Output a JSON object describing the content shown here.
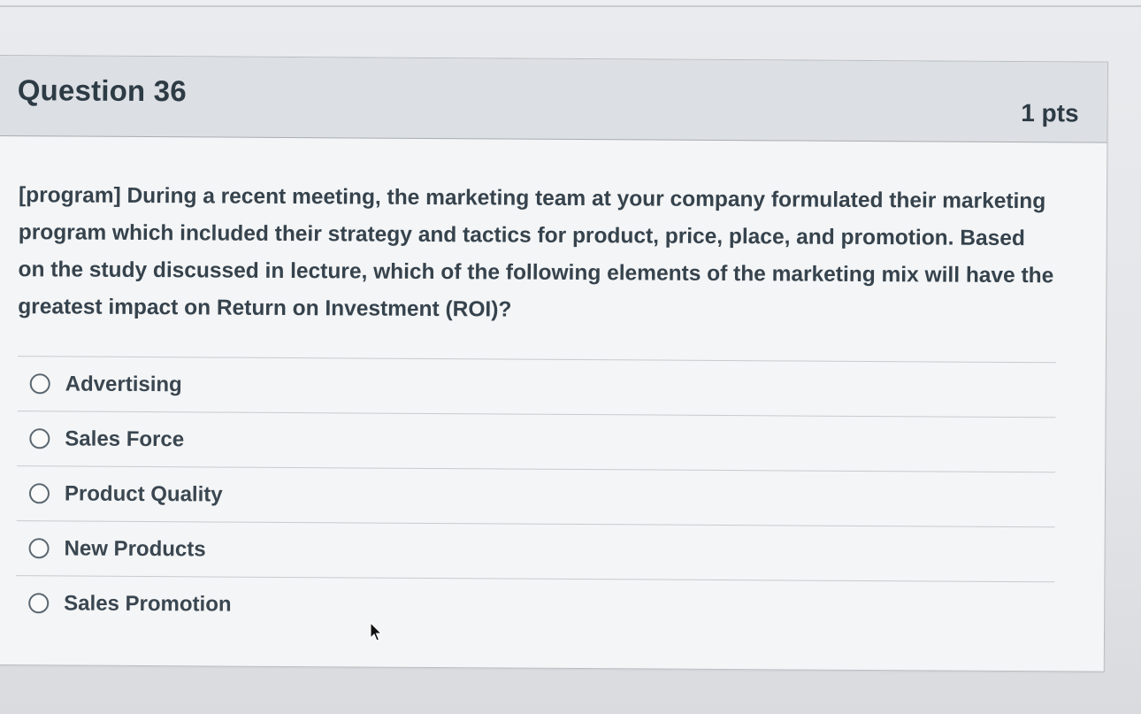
{
  "question": {
    "title": "Question 36",
    "points": "1 pts",
    "text": "[program] During a recent meeting, the marketing team at your company formulated their marketing program which included their strategy and tactics for product, price, place, and promotion. Based on the study discussed in lecture, which of the following elements of the marketing mix will have the greatest impact on Return on Investment (ROI)?",
    "answers": [
      {
        "label": "Advertising",
        "selected": false
      },
      {
        "label": "Sales Force",
        "selected": false
      },
      {
        "label": "Product Quality",
        "selected": false
      },
      {
        "label": "New Products",
        "selected": false
      },
      {
        "label": "Sales Promotion",
        "selected": false
      }
    ]
  },
  "icons": {
    "radio": "radio-button-icon",
    "cursor": "mouse-pointer-icon"
  },
  "colors": {
    "header_bg": "#dcdfe3",
    "body_bg": "#f4f5f6",
    "text": "#2d3b45",
    "divider": "#c7cbcf"
  }
}
